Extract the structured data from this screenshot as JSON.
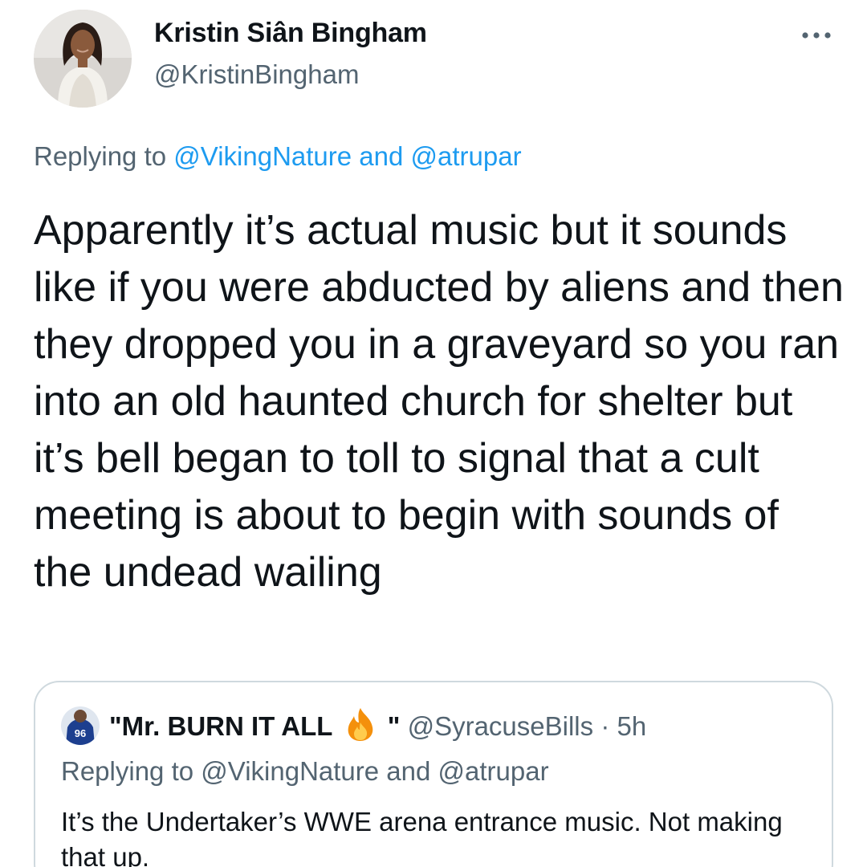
{
  "tweet": {
    "author": {
      "display_name": "Kristin Siân Bingham",
      "handle": "@KristinBingham",
      "avatar_icon": "profile-photo"
    },
    "more_icon": "more-horizontal-icon",
    "replying_to": {
      "prefix": "Replying to",
      "user1": "@VikingNature",
      "conjunction": "and",
      "user2": "@atrupar"
    },
    "text": "Apparently it’s actual music but it sounds like if you were abducted by aliens and then they dropped you in a graveyard so you ran into an old haunted church for shelter but it’s bell began to toll to signal that a cult meeting is about to begin with sounds of the undead wailing"
  },
  "quoted_tweet": {
    "display_name_start": "\"Mr. BURN IT ALL",
    "display_name_end": "\"",
    "emoji_icon": "fire-icon",
    "handle": "@SyracuseBills",
    "separator": "·",
    "timestamp": "5h",
    "replying_to": {
      "prefix": "Replying to",
      "user1": "@VikingNature",
      "conjunction": "and",
      "user2": "@atrupar"
    },
    "text": "It’s the Undertaker’s WWE arena entrance music. Not making that up."
  },
  "colors": {
    "text": "#0f1419",
    "secondary": "#536471",
    "link": "#1d9bf0",
    "border": "#cfd9de"
  }
}
